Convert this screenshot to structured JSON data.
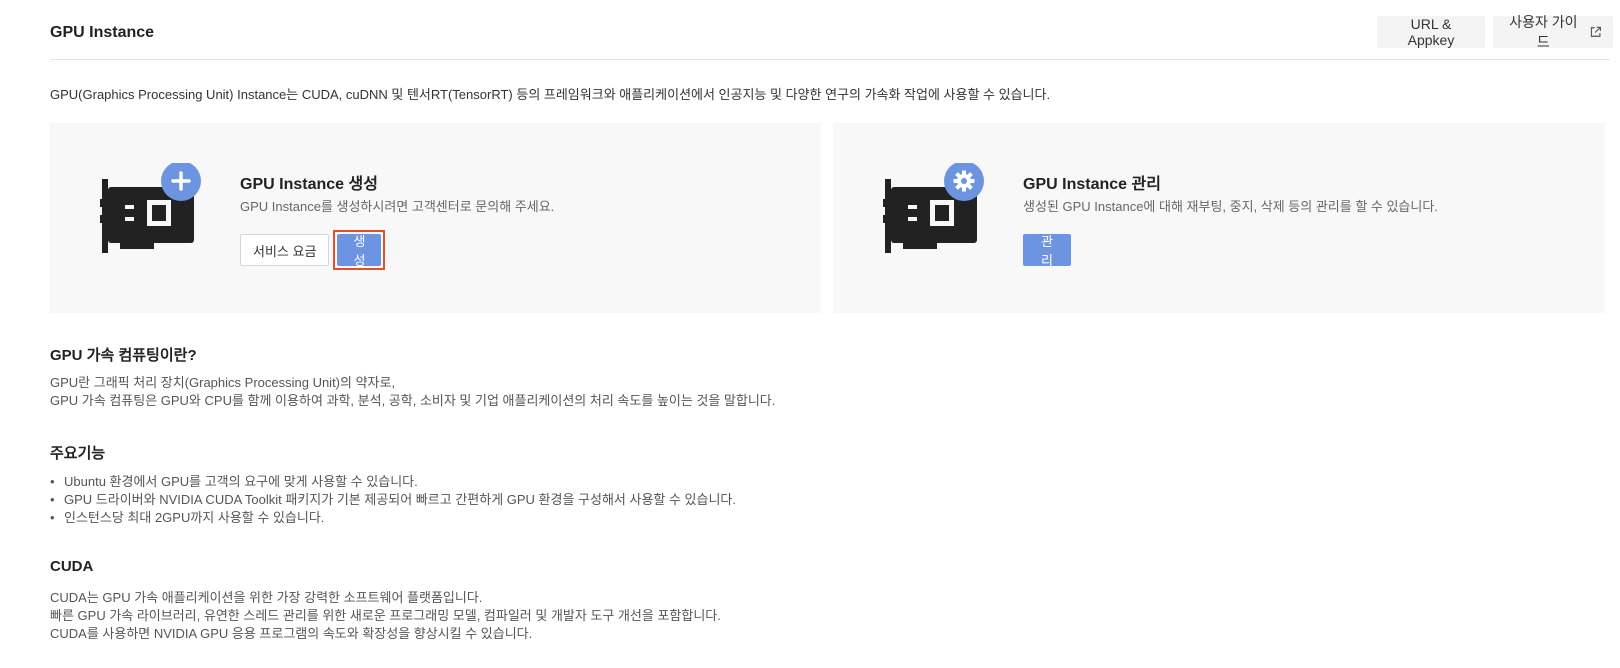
{
  "header": {
    "title": "GPU Instance",
    "appkey_label": "URL & Appkey",
    "guide_label": "사용자 가이드"
  },
  "intro": "GPU(Graphics Processing Unit) Instance는 CUDA, cuDNN 및 텐서RT(TensorRT) 등의 프레임워크와 애플리케이션에서 인공지능 및 다양한 연구의 가속화 작업에 사용할 수 있습니다.",
  "cards": {
    "create": {
      "title": "GPU Instance 생성",
      "desc": "GPU Instance를 생성하시려면 고객센터로 문의해 주세요.",
      "pricing_label": "서비스 요금",
      "create_label": "생성",
      "badge_icon": "plus-icon"
    },
    "manage": {
      "title": "GPU Instance 관리",
      "desc": "생성된 GPU Instance에 대해 재부팅, 중지, 삭제 등의 관리를 할 수 있습니다.",
      "manage_label": "관리",
      "badge_icon": "gear-icon"
    }
  },
  "sections": {
    "what": {
      "title": "GPU 가속 컴퓨팅이란?",
      "lines": [
        "GPU란 그래픽 처리 장치(Graphics Processing Unit)의 약자로,",
        "GPU 가속 컴퓨팅은 GPU와 CPU를 함께 이용하여 과학, 분석, 공학, 소비자 및 기업 애플리케이션의 처리 속도를 높이는 것을 말합니다."
      ]
    },
    "features": {
      "title": "주요기능",
      "items": [
        "Ubuntu 환경에서 GPU를 고객의 요구에 맞게 사용할 수 있습니다.",
        "GPU 드라이버와 NVIDIA CUDA Toolkit 패키지가 기본 제공되어 빠르고 간편하게 GPU 환경을 구성해서 사용할 수 있습니다.",
        "인스턴스당 최대 2GPU까지 사용할 수 있습니다."
      ]
    },
    "cuda": {
      "title": "CUDA",
      "lines": [
        "CUDA는 GPU 가속 애플리케이션을 위한 가장 강력한 소프트웨어 플랫폼입니다.",
        "빠른 GPU 가속 라이브러리, 유연한 스레드 관리를 위한 새로운 프로그래밍 모델, 컴파일러 및 개발자 도구 개선을 포함합니다.",
        "CUDA를 사용하면 NVIDIA GPU 응용 프로그램의 속도와 확장성을 향상시킬 수 있습니다."
      ]
    }
  },
  "colors": {
    "accent": "#6d94e0",
    "highlight": "#e2502a",
    "card_bg": "#f8f8f8",
    "icon_dark": "#222222"
  }
}
